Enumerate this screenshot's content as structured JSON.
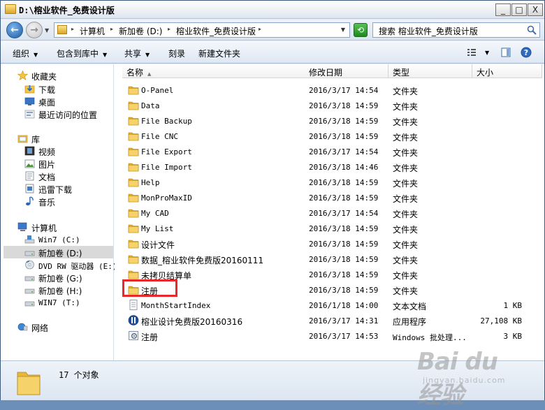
{
  "window": {
    "title": "D:\\榕业软件_免费设计版",
    "minimize": "_",
    "maximize": "□",
    "close": "X"
  },
  "address": {
    "crumbs": [
      "计算机",
      "新加卷 (D:)",
      "榕业软件_免费设计版"
    ],
    "search_placeholder": "搜索 榕业软件_免费设计版"
  },
  "toolbar": {
    "organize": "组织",
    "include_library": "包含到库中",
    "share": "共享",
    "burn": "刻录",
    "new_folder": "新建文件夹"
  },
  "nav": {
    "favorites": "收藏夹",
    "downloads": "下载",
    "desktop": "桌面",
    "recent": "最近访问的位置",
    "libraries": "库",
    "videos": "视频",
    "pictures": "图片",
    "documents": "文档",
    "xunlei": "迅雷下载",
    "music": "音乐",
    "computer": "计算机",
    "drive_c": "Win7 (C:)",
    "drive_d": "新加卷 (D:)",
    "drive_e": "DVD RW 驱动器 (E:)",
    "drive_g": "新加卷 (G:)",
    "drive_h": "新加卷 (H:)",
    "drive_t": "WIN7 (T:)",
    "network": "网络"
  },
  "columns": {
    "name": "名称",
    "date": "修改日期",
    "type": "类型",
    "size": "大小"
  },
  "files": [
    {
      "name": "O-Panel",
      "date": "2016/3/17 14:54",
      "type": "文件夹",
      "size": "",
      "kind": "folder"
    },
    {
      "name": "Data",
      "date": "2016/3/18 14:59",
      "type": "文件夹",
      "size": "",
      "kind": "folder"
    },
    {
      "name": "File Backup",
      "date": "2016/3/18 14:59",
      "type": "文件夹",
      "size": "",
      "kind": "folder"
    },
    {
      "name": "File CNC",
      "date": "2016/3/18 14:59",
      "type": "文件夹",
      "size": "",
      "kind": "folder"
    },
    {
      "name": "File Export",
      "date": "2016/3/17 14:54",
      "type": "文件夹",
      "size": "",
      "kind": "folder"
    },
    {
      "name": "File Import",
      "date": "2016/3/18 14:46",
      "type": "文件夹",
      "size": "",
      "kind": "folder"
    },
    {
      "name": "Help",
      "date": "2016/3/18 14:59",
      "type": "文件夹",
      "size": "",
      "kind": "folder"
    },
    {
      "name": "MonProMaxID",
      "date": "2016/3/18 14:59",
      "type": "文件夹",
      "size": "",
      "kind": "folder"
    },
    {
      "name": "My CAD",
      "date": "2016/3/17 14:54",
      "type": "文件夹",
      "size": "",
      "kind": "folder"
    },
    {
      "name": "My List",
      "date": "2016/3/18 14:59",
      "type": "文件夹",
      "size": "",
      "kind": "folder"
    },
    {
      "name": "设计文件",
      "date": "2016/3/18 14:59",
      "type": "文件夹",
      "size": "",
      "kind": "folder"
    },
    {
      "name": "数据_榕业软件免费版20160111",
      "date": "2016/3/18 14:59",
      "type": "文件夹",
      "size": "",
      "kind": "folder"
    },
    {
      "name": "未拷贝结算单",
      "date": "2016/3/18 14:59",
      "type": "文件夹",
      "size": "",
      "kind": "folder"
    },
    {
      "name": "注册",
      "date": "2016/3/18 14:59",
      "type": "文件夹",
      "size": "",
      "kind": "folder"
    },
    {
      "name": "MonthStartIndex",
      "date": "2016/1/18 14:00",
      "type": "文本文档",
      "size": "1 KB",
      "kind": "text"
    },
    {
      "name": "榕业设计免费版20160316",
      "date": "2016/3/17 14:31",
      "type": "应用程序",
      "size": "27,108 KB",
      "kind": "app"
    },
    {
      "name": "注册",
      "date": "2016/3/17 14:53",
      "type": "Windows 批处理...",
      "size": "3 KB",
      "kind": "batch"
    }
  ],
  "status": {
    "count": "17 个对象"
  },
  "watermark": {
    "logo": "Bai du 经验",
    "sub": "jingyan.baidu.com"
  },
  "colors": {
    "highlight_box": "#e8282b",
    "folder": "#f3c545",
    "selection": "#d9d9d9"
  }
}
